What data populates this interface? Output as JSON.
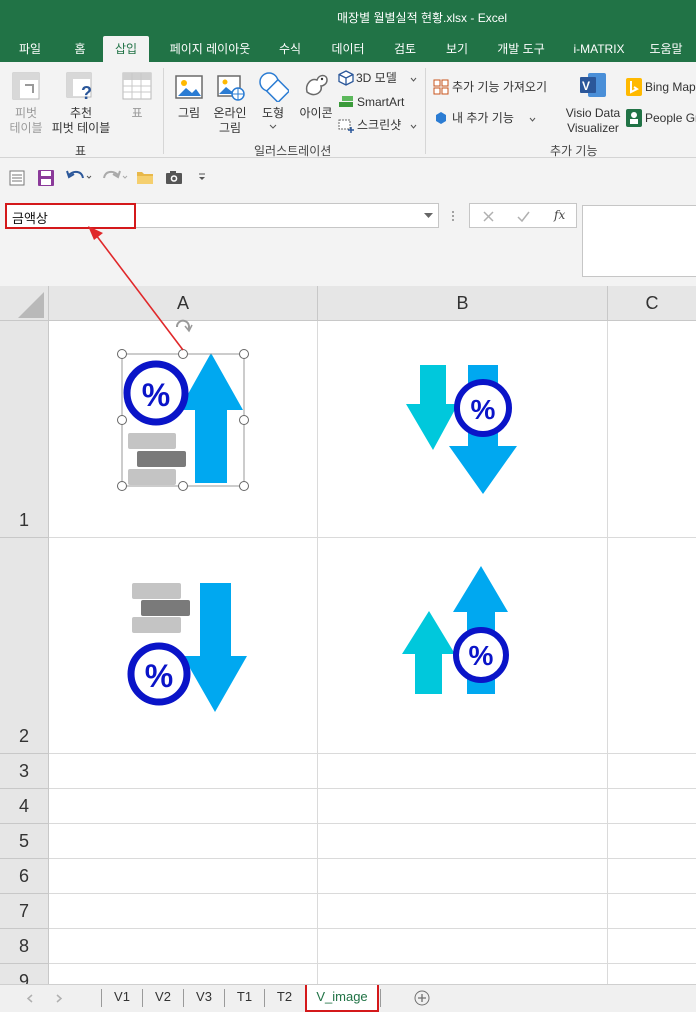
{
  "window": {
    "title": "매장별 월별실적 현황.xlsx  -  Excel"
  },
  "ribbon_tabs": [
    {
      "label": "파일"
    },
    {
      "label": "홈"
    },
    {
      "label": "삽입"
    },
    {
      "label": "페이지 레이아웃"
    },
    {
      "label": "수식"
    },
    {
      "label": "데이터"
    },
    {
      "label": "검토"
    },
    {
      "label": "보기"
    },
    {
      "label": "개발 도구"
    },
    {
      "label": "i-MATRIX"
    },
    {
      "label": "도움말"
    }
  ],
  "ribbon": {
    "tables": {
      "pivot_line1": "피벗",
      "pivot_line2": "테이블",
      "rec_line1": "추천",
      "rec_line2": "피벗 테이블",
      "table": "표",
      "group": "표"
    },
    "illustrations": {
      "picture": "그림",
      "online_line1": "온라인",
      "online_line2": "그림",
      "shapes": "도형",
      "icons": "아이콘",
      "model3d": "3D 모델",
      "smartart": "SmartArt",
      "screenshot": "스크린샷",
      "group": "일러스트레이션"
    },
    "addins": {
      "get": "추가 기능 가져오기",
      "my": "내 추가 기능",
      "visio_line1": "Visio Data",
      "visio_line2": "Visualizer",
      "bing": "Bing Map",
      "people": "People Gr",
      "group": "추가 기능"
    }
  },
  "formula_bar": {
    "name_box": "금액상",
    "fx": "fx"
  },
  "columns": [
    {
      "label": "A"
    },
    {
      "label": "B"
    },
    {
      "label": "C"
    }
  ],
  "rows": [
    {
      "label": "1"
    },
    {
      "label": "2"
    },
    {
      "label": "3"
    },
    {
      "label": "4"
    },
    {
      "label": "5"
    },
    {
      "label": "6"
    },
    {
      "label": "7"
    },
    {
      "label": "8"
    },
    {
      "label": "9"
    }
  ],
  "images": {
    "percent_symbol": "%"
  },
  "sheet_tabs": [
    {
      "label": "V1"
    },
    {
      "label": "V2"
    },
    {
      "label": "V3"
    },
    {
      "label": "T1"
    },
    {
      "label": "T2"
    },
    {
      "label": "V_image"
    }
  ],
  "colors": {
    "excel_green": "#217346",
    "arrow_cyan": "#00a8f0",
    "arrow_teal": "#00c8dc",
    "percent_blue": "#0a14c8",
    "highlight_red": "#d4191b"
  }
}
